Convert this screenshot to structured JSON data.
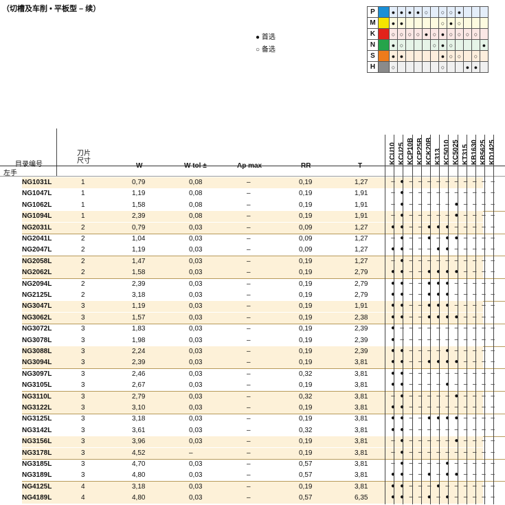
{
  "title": "（切槽及车削 • 平板型 – 续）",
  "legend": {
    "first": "● 首选",
    "alt": "○ 备选"
  },
  "iso_colors": {
    "P": "#1a8fd6",
    "M": "#f5e400",
    "K": "#e2231a",
    "N": "#26a44a",
    "S": "#ee7b1c",
    "H": "#8a8a8a"
  },
  "iso_rows": [
    {
      "label": "P",
      "cells": [
        "●",
        "●",
        "●",
        "●",
        "○",
        "",
        "○",
        "○",
        "●",
        "",
        "",
        ""
      ]
    },
    {
      "label": "M",
      "cells": [
        "●",
        "●",
        "",
        "",
        "",
        "",
        "○",
        "●",
        "○",
        "",
        "",
        ""
      ]
    },
    {
      "label": "K",
      "cells": [
        "○",
        "○",
        "○",
        "○",
        "●",
        "○",
        "●",
        "○",
        "○",
        "○",
        "○",
        ""
      ]
    },
    {
      "label": "N",
      "cells": [
        "●",
        "○",
        "",
        "",
        "",
        "○",
        "●",
        "○",
        "",
        "",
        "",
        "●"
      ]
    },
    {
      "label": "S",
      "cells": [
        "●",
        "●",
        "",
        "",
        "",
        "",
        "●",
        "○",
        "○",
        "",
        "○",
        ""
      ]
    },
    {
      "label": "H",
      "cells": [
        "○",
        "",
        "",
        "",
        "",
        "",
        "○",
        "",
        "",
        "●",
        "●",
        ""
      ]
    }
  ],
  "headers": {
    "catalog": "目录编号",
    "size": "刀片\n尺寸",
    "w": "W",
    "wtol": "W tol ±",
    "apmax": "Ap max",
    "rr": "RR",
    "t": "T"
  },
  "grades": [
    "KCU10",
    "KCU25",
    "KCP10B",
    "KCP25B",
    "KCK20B",
    "K313",
    "KC5010",
    "KC5025",
    "KT315",
    "KB1630",
    "KB5625",
    "KD1425"
  ],
  "section_label": "左手",
  "rows": [
    {
      "code": "NG1031L",
      "size": "1",
      "w": "0,79",
      "wt": "0,08",
      "ap": "–",
      "rr": "0,19",
      "t": "1,27",
      "g": "-●----------"
    },
    {
      "code": "NG1047L",
      "size": "1",
      "w": "1,19",
      "wt": "0,08",
      "ap": "–",
      "rr": "0,19",
      "t": "1,91",
      "g": "-●----------"
    },
    {
      "code": "NG1062L",
      "size": "1",
      "w": "1,58",
      "wt": "0,08",
      "ap": "–",
      "rr": "0,19",
      "t": "1,91",
      "g": "-●-----●----"
    },
    {
      "code": "NG1094L",
      "size": "1",
      "w": "2,39",
      "wt": "0,08",
      "ap": "–",
      "rr": "0,19",
      "t": "1,91",
      "g": "-●-----●----"
    },
    {
      "code": "NG2031L",
      "size": "2",
      "w": "0,79",
      "wt": "0,03",
      "ap": "–",
      "rr": "0,09",
      "t": "1,27",
      "g": "●●--●●●-----"
    },
    {
      "code": "NG2041L",
      "size": "2",
      "w": "1,04",
      "wt": "0,03",
      "ap": "–",
      "rr": "0,09",
      "t": "1,27",
      "g": "-●--●-●●----"
    },
    {
      "code": "NG2047L",
      "size": "2",
      "w": "1,19",
      "wt": "0,03",
      "ap": "–",
      "rr": "0,09",
      "t": "1,27",
      "g": "●●---●●-----"
    },
    {
      "code": "NG2058L",
      "size": "2",
      "w": "1,47",
      "wt": "0,03",
      "ap": "–",
      "rr": "0,19",
      "t": "1,27",
      "g": "-●----------"
    },
    {
      "code": "NG2062L",
      "size": "2",
      "w": "1,58",
      "wt": "0,03",
      "ap": "–",
      "rr": "0,19",
      "t": "2,79",
      "g": "●●--●●●●----"
    },
    {
      "code": "NG2094L",
      "size": "2",
      "w": "2,39",
      "wt": "0,03",
      "ap": "–",
      "rr": "0,19",
      "t": "2,79",
      "g": "●●--●●●-----"
    },
    {
      "code": "NG2125L",
      "size": "2",
      "w": "3,18",
      "wt": "0,03",
      "ap": "–",
      "rr": "0,19",
      "t": "2,79",
      "g": "●●--●●●-----"
    },
    {
      "code": "NG3047L",
      "size": "3",
      "w": "1,19",
      "wt": "0,03",
      "ap": "–",
      "rr": "0,19",
      "t": "1,91",
      "g": "●●--●●●-----"
    },
    {
      "code": "NG3062L",
      "size": "3",
      "w": "1,57",
      "wt": "0,03",
      "ap": "–",
      "rr": "0,19",
      "t": "2,38",
      "g": "●●--●●●●----"
    },
    {
      "code": "NG3072L",
      "size": "3",
      "w": "1,83",
      "wt": "0,03",
      "ap": "–",
      "rr": "0,19",
      "t": "2,39",
      "g": "●-----------"
    },
    {
      "code": "NG3078L",
      "size": "3",
      "w": "1,98",
      "wt": "0,03",
      "ap": "–",
      "rr": "0,19",
      "t": "2,39",
      "g": "●-----------"
    },
    {
      "code": "NG3088L",
      "size": "3",
      "w": "2,24",
      "wt": "0,03",
      "ap": "–",
      "rr": "0,19",
      "t": "2,39",
      "g": "●●----●-----"
    },
    {
      "code": "NG3094L",
      "size": "3",
      "w": "2,39",
      "wt": "0,03",
      "ap": "–",
      "rr": "0,19",
      "t": "3,81",
      "g": "●●--●●●●----"
    },
    {
      "code": "NG3097L",
      "size": "3",
      "w": "2,46",
      "wt": "0,03",
      "ap": "–",
      "rr": "0,32",
      "t": "3,81",
      "g": "●●----------"
    },
    {
      "code": "NG3105L",
      "size": "3",
      "w": "2,67",
      "wt": "0,03",
      "ap": "–",
      "rr": "0,19",
      "t": "3,81",
      "g": "●●----●-----"
    },
    {
      "code": "NG3110L",
      "size": "3",
      "w": "2,79",
      "wt": "0,03",
      "ap": "–",
      "rr": "0,32",
      "t": "3,81",
      "g": "-●-----●----"
    },
    {
      "code": "NG3122L",
      "size": "3",
      "w": "3,10",
      "wt": "0,03",
      "ap": "–",
      "rr": "0,19",
      "t": "3,81",
      "g": "●●----------"
    },
    {
      "code": "NG3125L",
      "size": "3",
      "w": "3,18",
      "wt": "0,03",
      "ap": "–",
      "rr": "0,19",
      "t": "3,81",
      "g": "●●--●●●●----"
    },
    {
      "code": "NG3142L",
      "size": "3",
      "w": "3,61",
      "wt": "0,03",
      "ap": "–",
      "rr": "0,32",
      "t": "3,81",
      "g": "●●----------"
    },
    {
      "code": "NG3156L",
      "size": "3",
      "w": "3,96",
      "wt": "0,03",
      "ap": "–",
      "rr": "0,19",
      "t": "3,81",
      "g": "-●-----●----"
    },
    {
      "code": "NG3178L",
      "size": "3",
      "w": "4,52",
      "wt": "–",
      "ap": "–",
      "rr": "0,19",
      "t": "3,81",
      "g": "-●----------"
    },
    {
      "code": "NG3185L",
      "size": "3",
      "w": "4,70",
      "wt": "0,03",
      "ap": "–",
      "rr": "0,57",
      "t": "3,81",
      "g": "-●----●-----"
    },
    {
      "code": "NG3189L",
      "size": "3",
      "w": "4,80",
      "wt": "0,03",
      "ap": "–",
      "rr": "0,57",
      "t": "3,81",
      "g": "●●--●-●●----"
    },
    {
      "code": "NG4125L",
      "size": "4",
      "w": "3,18",
      "wt": "0,03",
      "ap": "–",
      "rr": "0,19",
      "t": "3,81",
      "g": "●●---●------"
    },
    {
      "code": "NG4189L",
      "size": "4",
      "w": "4,80",
      "wt": "0,03",
      "ap": "–",
      "rr": "0,57",
      "t": "6,35",
      "g": "●●--●-●-----"
    }
  ]
}
